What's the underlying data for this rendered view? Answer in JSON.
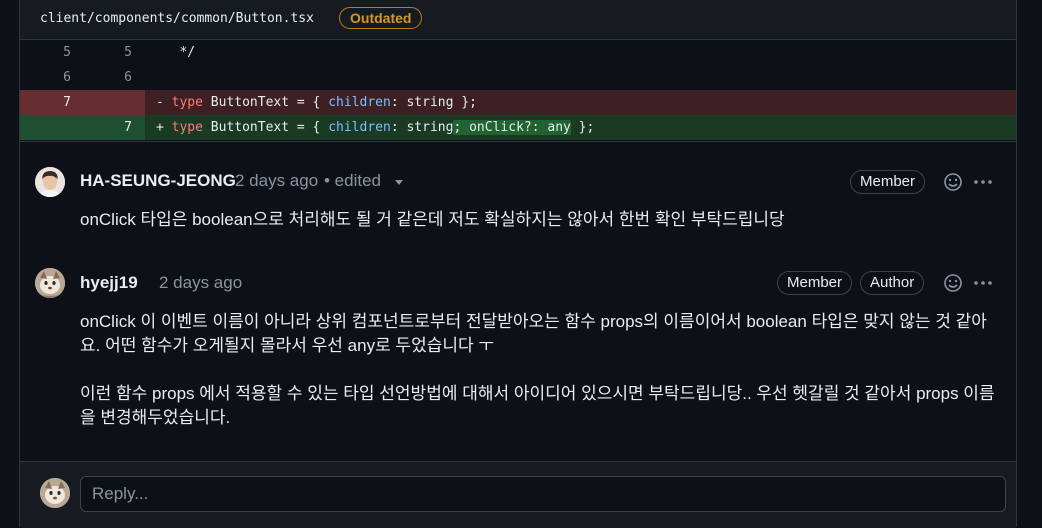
{
  "file": {
    "path": "client/components/common/Button.tsx",
    "status_badge": "Outdated"
  },
  "diff": {
    "rows": [
      {
        "old": "5",
        "new": "5",
        "code": "   */"
      },
      {
        "old": "6",
        "new": "6",
        "code": ""
      },
      {
        "old": "7",
        "new": "",
        "sign": "-",
        "kw": "type",
        "name": " ButtonText = { ",
        "prop": "children",
        "rest": ": string };"
      },
      {
        "old": "",
        "new": "7",
        "sign": "+",
        "kw": "type",
        "name": " ButtonText = { ",
        "prop": "children",
        "rest": ": string",
        "added": "; onClick?: any",
        "tail": " };"
      }
    ]
  },
  "comments": [
    {
      "author": "HA-SEUNG-JEONG",
      "time": "2 days ago",
      "edited": "• edited",
      "badges": [
        "Member"
      ],
      "body": [
        "onClick 타입은 boolean으로 처리해도 될 거 같은데 저도 확실하지는 않아서 한번 확인 부탁드립니당"
      ]
    },
    {
      "author": "hyejj19",
      "time": "2 days ago",
      "badges": [
        "Member",
        "Author"
      ],
      "body": [
        "onClick 이 이벤트 이름이 아니라 상위 컴포넌트로부터 전달받아오는 함수 props의 이름이어서 boolean 타입은 맞지 않는 것 같아요. 어떤 함수가 오게될지 몰라서 우선 any로 두었습니다 ㅜ",
        "이런 함수 props 에서 적용할 수 있는 타입 선언방법에 대해서 아이디어 있으시면 부탁드립니당.. 우선 헷갈릴 것 같아서 props 이름을 변경해두었습니다."
      ]
    }
  ],
  "reply": {
    "placeholder": "Reply..."
  },
  "icons": {
    "dropdown": "triangle-down-icon",
    "emoji": "smiley-icon",
    "more": "kebab-horizontal-icon"
  }
}
